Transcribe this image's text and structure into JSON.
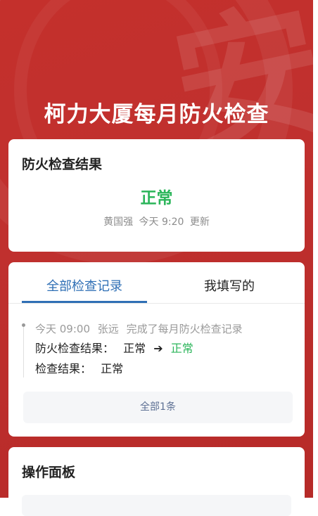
{
  "header": {
    "title": "柯力大厦每月防火检查",
    "watermark_glyph": "安"
  },
  "result_card": {
    "heading": "防火检查结果",
    "status": "正常",
    "status_color": "#2bb55a",
    "updated_by": "黄国强",
    "updated_time": "今天 9:20",
    "updated_suffix": "更新"
  },
  "records_card": {
    "tabs": [
      {
        "label": "全部检查记录",
        "active": true
      },
      {
        "label": "我填写的",
        "active": false
      }
    ],
    "accent_color": "#2f6fb5",
    "entries": [
      {
        "time": "今天 09:00",
        "user": "张远",
        "action": "完成了每月防火检查记录",
        "fields": [
          {
            "label": "防火检查结果：",
            "old_value": "正常",
            "new_value": "正常"
          },
          {
            "label": "检查结果：",
            "value": "正常"
          }
        ]
      }
    ],
    "more_label": "全部1条"
  },
  "panel_card": {
    "heading": "操作面板"
  },
  "colors": {
    "hero_red": "#c4302c"
  }
}
